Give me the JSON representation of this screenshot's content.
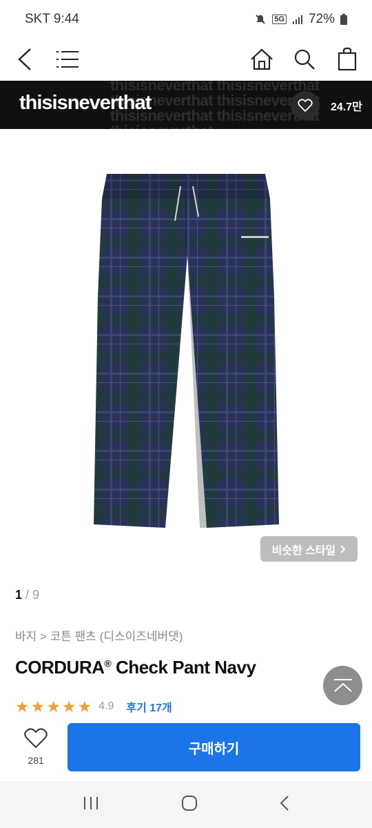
{
  "status_bar": {
    "carrier_time": "SKT 9:44",
    "network": "5G",
    "battery": "72%"
  },
  "top_nav": {
    "icons": [
      "back-arrow-icon",
      "menu-icon",
      "home-icon",
      "search-icon",
      "shopping-bag-icon"
    ]
  },
  "brand": {
    "name": "thisisneverthat",
    "watermark_lines": [
      "thisisneverthat  thisisneverthat",
      "thisisneverthat  thisisneverthat",
      "thisisneverthat  thisisneverthat",
      "thisisneverthat"
    ],
    "like_count": "24.7만"
  },
  "gallery": {
    "similar_style_label": "비슷한 스타일",
    "current_page": "1",
    "page_separator": " / ",
    "total_pages": "9"
  },
  "product": {
    "breadcrumb": "바지 > 코튼 팬츠 (디스이즈네버댓)",
    "title_main": "CORDURA",
    "title_mark": "®",
    "title_rest": " Check Pant Navy",
    "rating_stars": 5,
    "rating_value": "4.9",
    "review_label": "후기 17개"
  },
  "bottom_bar": {
    "wish_count": "281",
    "buy_label": "구매하기"
  },
  "colors": {
    "accent_blue": "#1c75e6",
    "star_orange": "#f39c3a",
    "banner_black": "#101010",
    "pant_navy": "#2b3258"
  }
}
